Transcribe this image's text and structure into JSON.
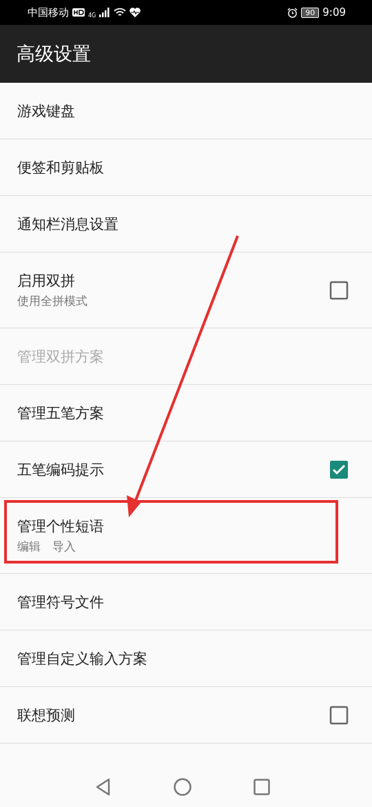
{
  "status_bar": {
    "carrier": "中国移动",
    "network": "4G",
    "battery": "90",
    "time": "9:09"
  },
  "app_bar": {
    "title": "高级设置"
  },
  "items": [
    {
      "kind": "plain",
      "title": "游戏键盘",
      "disabled": false
    },
    {
      "kind": "plain",
      "title": "便签和剪贴板",
      "disabled": false
    },
    {
      "kind": "plain",
      "title": "通知栏消息设置",
      "disabled": false
    },
    {
      "kind": "checkbox",
      "title": "启用双拼",
      "subtitle": "使用全拼模式",
      "checked": false,
      "disabled": false
    },
    {
      "kind": "plain",
      "title": "管理双拼方案",
      "disabled": true
    },
    {
      "kind": "plain",
      "title": "管理五笔方案",
      "disabled": false
    },
    {
      "kind": "checkbox",
      "title": "五笔编码提示",
      "checked": true,
      "disabled": false
    },
    {
      "kind": "plain",
      "title": "管理个性短语",
      "subtitle": "编辑　导入",
      "disabled": false
    },
    {
      "kind": "plain",
      "title": "管理符号文件",
      "disabled": false
    },
    {
      "kind": "plain",
      "title": "管理自定义输入方案",
      "disabled": false
    },
    {
      "kind": "checkbox",
      "title": "联想预测",
      "checked": false,
      "disabled": false
    }
  ]
}
